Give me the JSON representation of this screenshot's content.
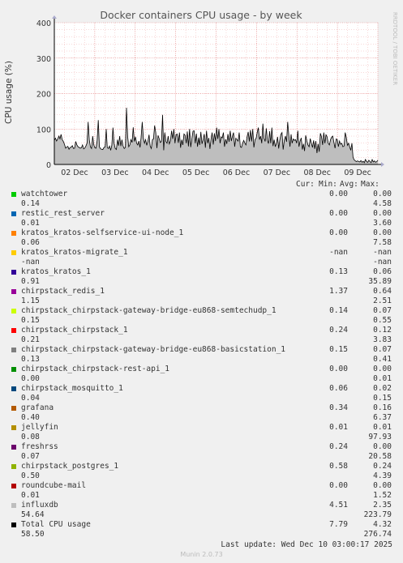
{
  "chart_data": {
    "type": "area",
    "title": "Docker containers CPU usage - by week",
    "ylabel": "CPU usage (%)",
    "ylim": [
      0,
      400
    ],
    "yticks": [
      "0",
      "100",
      "200",
      "300",
      "400"
    ],
    "xticks": [
      "02 Dec",
      "03 Dec",
      "04 Dec",
      "05 Dec",
      "06 Dec",
      "07 Dec",
      "08 Dec",
      "09 Dec"
    ],
    "grid": true,
    "side_label": "RRDTOOL / TOBI OETIKER",
    "stack_values": [
      68,
      74,
      66,
      72,
      80,
      72,
      85,
      70,
      65,
      57,
      46,
      49,
      51,
      43,
      48,
      49,
      53,
      45,
      46,
      65,
      55,
      50,
      48,
      46,
      47,
      55,
      44,
      46,
      52,
      60,
      120,
      70,
      50,
      45,
      80,
      55,
      47,
      46,
      68,
      125,
      50,
      44,
      43,
      42,
      48,
      49,
      100,
      48,
      45,
      52,
      40,
      54,
      104,
      60,
      45,
      42,
      70,
      53,
      80,
      52,
      70,
      52,
      45,
      48,
      160,
      80,
      50,
      55,
      70,
      62,
      105,
      65,
      78,
      60,
      55,
      66,
      48,
      76,
      120,
      74,
      60,
      70,
      54,
      65,
      84,
      52,
      45,
      70,
      72,
      110,
      90,
      46,
      82,
      73,
      62,
      65,
      140,
      40,
      90,
      65,
      60,
      80,
      58,
      66,
      95,
      72,
      100,
      60,
      84,
      86,
      61,
      90,
      47,
      70,
      55,
      86,
      82,
      60,
      93,
      51,
      100,
      49,
      72,
      94,
      95,
      60,
      87,
      50,
      76,
      55,
      92,
      58,
      70,
      86,
      47,
      95,
      60,
      75,
      44,
      70,
      90,
      56,
      88,
      66,
      104,
      72,
      100,
      60,
      78,
      75,
      90,
      50,
      71,
      58,
      86,
      64,
      95,
      66,
      80,
      90,
      50,
      74,
      70,
      66,
      90,
      50,
      48,
      60,
      68,
      60,
      55,
      78,
      92,
      65,
      97,
      65,
      100,
      48,
      70,
      74,
      90,
      104,
      70,
      80,
      60,
      115,
      74,
      65,
      102,
      68,
      59,
      94,
      60,
      104,
      52,
      70,
      50,
      60,
      78,
      45,
      68,
      85,
      90,
      42,
      68,
      80,
      64,
      120,
      82,
      50,
      85,
      60,
      72,
      68,
      70,
      60,
      95,
      50,
      66,
      75,
      42,
      58,
      38,
      82,
      67,
      55,
      50,
      73,
      60,
      48,
      68,
      44,
      66,
      32,
      58,
      36,
      88,
      78,
      55,
      90,
      60,
      84,
      78,
      60,
      55,
      70,
      77,
      80,
      62,
      46,
      72,
      70,
      50,
      66,
      57,
      60,
      50,
      52,
      90,
      76,
      54,
      60,
      50,
      40,
      60,
      20,
      13,
      10,
      8,
      10,
      8,
      7,
      11,
      6,
      9,
      5,
      14,
      8,
      6,
      12,
      8,
      5,
      14,
      7,
      10,
      6,
      8,
      12
    ],
    "series": [
      {
        "name": "watchtower",
        "color": "#00cc00",
        "cur": "0.00",
        "min": "0.00",
        "avg": "0.14",
        "max": "4.58"
      },
      {
        "name": "restic_rest_server",
        "color": "#0066b3",
        "cur": "0.00",
        "min": "0.00",
        "avg": "0.01",
        "max": "3.60"
      },
      {
        "name": "kratos_kratos-selfservice-ui-node_1",
        "color": "#ff8000",
        "cur": "0.00",
        "min": "0.00",
        "avg": "0.06",
        "max": "7.58"
      },
      {
        "name": "kratos_kratos-migrate_1",
        "color": "#ffcc00",
        "cur": "-nan",
        "min": "-nan",
        "avg": "-nan",
        "max": "-nan"
      },
      {
        "name": "kratos_kratos_1",
        "color": "#330099",
        "cur": "0.13",
        "min": "0.06",
        "avg": "0.91",
        "max": "35.89"
      },
      {
        "name": "chirpstack_redis_1",
        "color": "#990099",
        "cur": "1.37",
        "min": "0.64",
        "avg": "1.15",
        "max": "2.51"
      },
      {
        "name": "chirpstack_chirpstack-gateway-bridge-eu868-semtechudp_1",
        "color": "#ccff00",
        "cur": "0.14",
        "min": "0.07",
        "avg": "0.15",
        "max": "0.55"
      },
      {
        "name": "chirpstack_chirpstack_1",
        "color": "#ff0000",
        "cur": "0.24",
        "min": "0.12",
        "avg": "0.21",
        "max": "3.83"
      },
      {
        "name": "chirpstack_chirpstack-gateway-bridge-eu868-basicstation_1",
        "color": "#808080",
        "cur": "0.15",
        "min": "0.07",
        "avg": "0.13",
        "max": "0.41"
      },
      {
        "name": "chirpstack_chirpstack-rest-api_1",
        "color": "#008f00",
        "cur": "0.00",
        "min": "0.00",
        "avg": "0.00",
        "max": "0.01"
      },
      {
        "name": "chirpstack_mosquitto_1",
        "color": "#00487d",
        "cur": "0.06",
        "min": "0.02",
        "avg": "0.04",
        "max": "0.15"
      },
      {
        "name": "grafana",
        "color": "#b35a00",
        "cur": "0.34",
        "min": "0.16",
        "avg": "0.40",
        "max": "6.37"
      },
      {
        "name": "jellyfin",
        "color": "#b38f00",
        "cur": "0.01",
        "min": "0.01",
        "avg": "0.08",
        "max": "97.93"
      },
      {
        "name": "freshrss",
        "color": "#6b006b",
        "cur": "0.24",
        "min": "0.00",
        "avg": "0.07",
        "max": "20.58"
      },
      {
        "name": "chirpstack_postgres_1",
        "color": "#8fb300",
        "cur": "0.58",
        "min": "0.24",
        "avg": "0.50",
        "max": "4.39"
      },
      {
        "name": "roundcube-mail",
        "color": "#b30000",
        "cur": "0.00",
        "min": "0.00",
        "avg": "0.01",
        "max": "1.52"
      },
      {
        "name": "influxdb",
        "color": "#bebebe",
        "cur": "4.51",
        "min": "2.35",
        "avg": "54.64",
        "max": "223.79"
      },
      {
        "name": "Total CPU usage",
        "color": "#000000",
        "cur": "7.79",
        "min": "4.32",
        "avg": "58.50",
        "max": "276.74"
      }
    ]
  },
  "legend_header": {
    "cur": "Cur:",
    "min": "Min:",
    "avg": "Avg:",
    "max": "Max:"
  },
  "last_update": "Last update: Wed Dec 10 03:00:17 2025",
  "version": "Munin 2.0.73"
}
